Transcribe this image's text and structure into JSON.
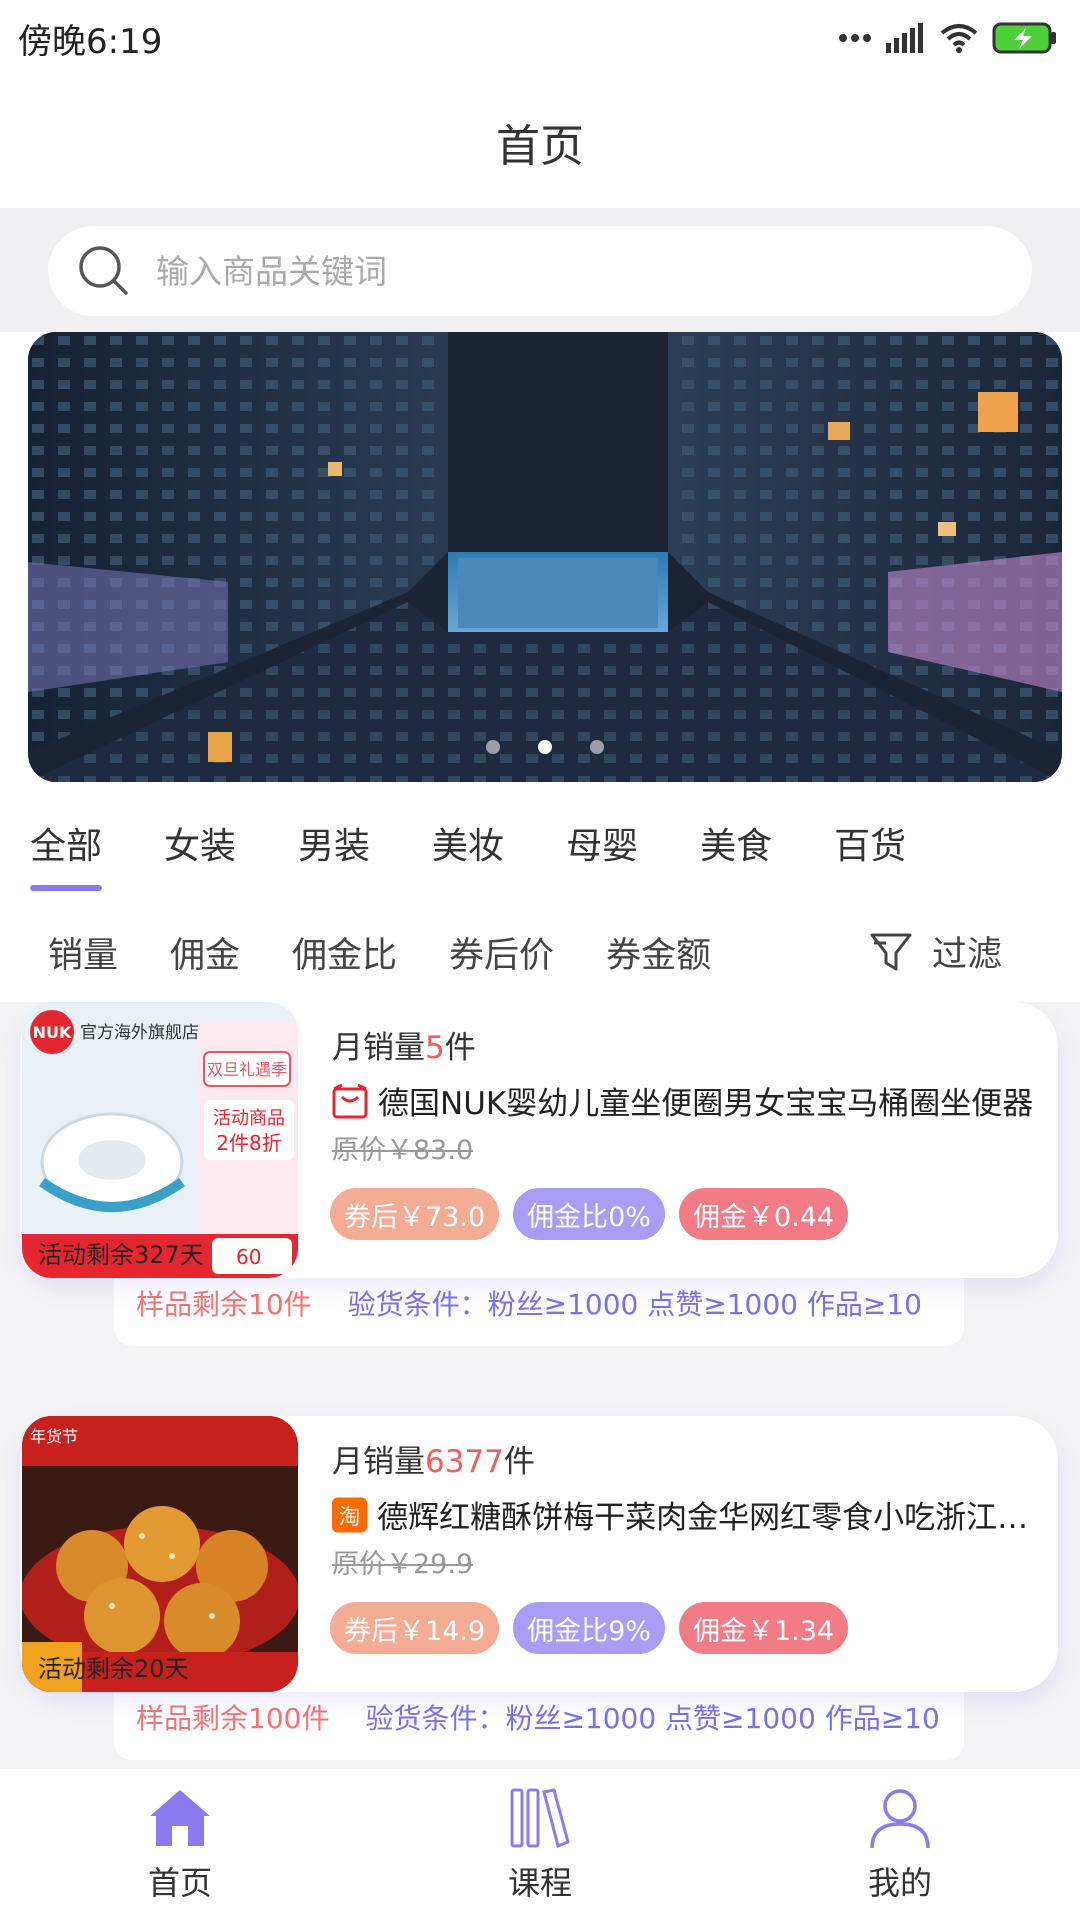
{
  "status": {
    "time": "傍晚6:19"
  },
  "header": {
    "title": "首页"
  },
  "search": {
    "placeholder": "输入商品关键词"
  },
  "tabs": [
    "全部",
    "女装",
    "男装",
    "美妆",
    "母婴",
    "美食",
    "百货"
  ],
  "sort": [
    "销量",
    "佣金",
    "佣金比",
    "券后价",
    "券金额"
  ],
  "filter_label": "过滤",
  "products": [
    {
      "thumb_label": "活动剩余327天",
      "sales_prefix": "月销量",
      "sales_num": "5",
      "sales_suffix": "件",
      "title": "德国NUK婴幼儿童坐便圈男女宝宝马桶圈坐便器",
      "orig_price": "原价￥83.0",
      "coupon_price": "券后￥73.0",
      "ratio": "佣金比0%",
      "commission": "佣金￥0.44",
      "sample": "样品剩余10件",
      "condition": "验货条件：粉丝≥1000 点赞≥1000 作品≥10"
    },
    {
      "thumb_label": "活动剩余20天",
      "sales_prefix": "月销量",
      "sales_num": "6377",
      "sales_suffix": "件",
      "title": "德辉红糖酥饼梅干菜肉金华网红零食小吃浙江特产",
      "orig_price": "原价￥29.9",
      "coupon_price": "券后￥14.9",
      "ratio": "佣金比9%",
      "commission": "佣金￥1.34",
      "sample": "样品剩余100件",
      "condition": "验货条件：粉丝≥1000 点赞≥1000 作品≥10"
    }
  ],
  "nav": {
    "home": "首页",
    "course": "课程",
    "mine": "我的"
  },
  "colors": {
    "accent": "#8c7bf0",
    "red": "#f05e5e",
    "coupon": "#f4ac95",
    "ratio": "#a89cf4",
    "commission": "#f37b86"
  }
}
